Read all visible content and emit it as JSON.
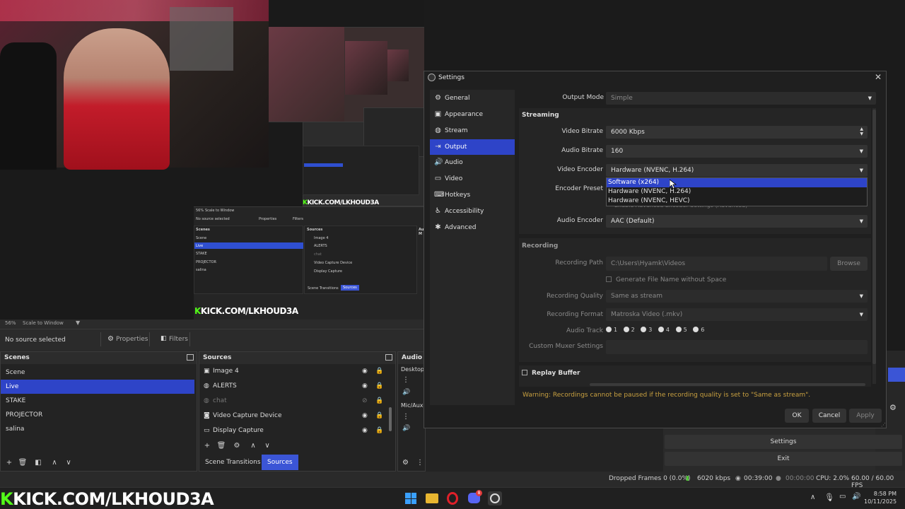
{
  "preview": {
    "kick_logo": "KICK.COM/LKHOUD3A",
    "mini": {
      "zoom": "56%",
      "scale": "Scale to Window",
      "no_source": "No source selected",
      "properties": "Properties",
      "filters": "Filters",
      "scenes_title": "Scenes",
      "sources_title": "Sources",
      "audio_title": "Audio M",
      "scenes": [
        "Scene",
        "Live",
        "STAKE",
        "PROJECTOR",
        "salina"
      ],
      "sources": [
        "Image 4",
        "ALERTS",
        "chat",
        "Video Capture Device",
        "Display Capture"
      ],
      "tabs": [
        "Scene Transitions",
        "Sources"
      ]
    }
  },
  "toolbar": {
    "zoom": "56%",
    "scale": "Scale to Window",
    "no_source": "No source selected",
    "properties": "Properties",
    "filters": "Filters"
  },
  "scenes": {
    "title": "Scenes",
    "items": [
      "Scene",
      "Live",
      "STAKE",
      "PROJECTOR",
      "salina"
    ],
    "selected": "Live"
  },
  "sources": {
    "title": "Sources",
    "items": [
      "Image 4",
      "ALERTS",
      "chat",
      "Video Capture Device",
      "Display Capture"
    ],
    "tabs": [
      "Scene Transitions",
      "Sources"
    ]
  },
  "audio": {
    "title": "Audio M",
    "ch1": "Desktop",
    "ch2": "Mic/Aux"
  },
  "controls": {
    "settings": "Settings",
    "exit": "Exit"
  },
  "status": {
    "dropped": "Dropped Frames 0 (0.0%)",
    "bitrate": "6020 kbps",
    "stream_time": "00:39:00",
    "rec_time": "00:00:00",
    "cpu": "CPU: 2.0%",
    "fps": "60.00 / 60.00 FPS"
  },
  "taskbar": {
    "time": "8:58 PM",
    "date": "10/11/2025",
    "badge": "8"
  },
  "settings": {
    "title": "Settings",
    "nav": [
      "General",
      "Appearance",
      "Stream",
      "Output",
      "Audio",
      "Video",
      "Hotkeys",
      "Accessibility",
      "Advanced"
    ],
    "nav_selected": "Output",
    "output_mode_label": "Output Mode",
    "output_mode": "Simple",
    "streaming_title": "Streaming",
    "video_bitrate_label": "Video Bitrate",
    "video_bitrate": "6000 Kbps",
    "audio_bitrate_label": "Audio Bitrate",
    "audio_bitrate": "160",
    "video_encoder_label": "Video Encoder",
    "video_encoder": "Hardware (NVENC, H.264)",
    "encoder_preset_label": "Encoder Preset",
    "encoder_options": [
      "Software (x264)",
      "Hardware (NVENC, H.264)",
      "Hardware (NVENC, HEVC)"
    ],
    "encoder_hover": "Software (x264)",
    "hidden_text": "Enable Advanced Encoder Settings (Advanced)",
    "audio_encoder_label": "Audio Encoder",
    "audio_encoder": "AAC (Default)",
    "recording_title": "Recording",
    "recording_path_label": "Recording Path",
    "recording_path": "C:\\Users\\Hyamk\\Videos",
    "browse": "Browse",
    "gen_filename": "Generate File Name without Space",
    "rec_quality_label": "Recording Quality",
    "rec_quality": "Same as stream",
    "rec_format_label": "Recording Format",
    "rec_format": "Matroska Video (.mkv)",
    "audio_track_label": "Audio Track",
    "audio_tracks": [
      "1",
      "2",
      "3",
      "4",
      "5",
      "6"
    ],
    "muxer_label": "Custom Muxer Settings",
    "replay_buffer": "Replay Buffer",
    "warning": "Warning: Recordings cannot be paused if the recording quality is set to \"Same as stream\".",
    "ok": "OK",
    "cancel": "Cancel",
    "apply": "Apply"
  }
}
